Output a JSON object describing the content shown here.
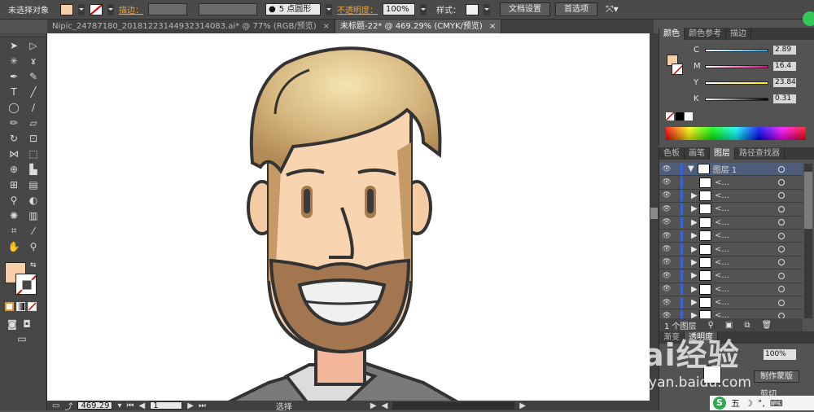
{
  "control_bar": {
    "selection_label": "未选择对象",
    "fill_color": "#f6cfa7",
    "stroke_label": "描边：",
    "brush_value": "5 点圆形",
    "opacity_label": "不透明度：",
    "opacity_value": "100%",
    "style_label": "样式：",
    "doc_setup_button": "文档设置",
    "prefs_button": "首选项"
  },
  "tabs": [
    {
      "label": "Nipic_24787180_20181223144932314083.ai* @ 77% (RGB/预览)",
      "close": "×"
    },
    {
      "label": "未标题-22* @ 469.29% (CMYK/预览)",
      "close": "×"
    }
  ],
  "status_bar": {
    "zoom": "469.29",
    "page": "1",
    "mode": "选择"
  },
  "color_panel": {
    "tabs": [
      "颜色",
      "颜色参考",
      "描边"
    ],
    "channels": [
      {
        "name": "C",
        "value": "2.89",
        "gradient": "linear-gradient(to right,#fff,#00aeef)"
      },
      {
        "name": "M",
        "value": "16.4",
        "gradient": "linear-gradient(to right,#fff,#ec008c)"
      },
      {
        "name": "Y",
        "value": "23.84",
        "gradient": "linear-gradient(to right,#fff,#fff200)"
      },
      {
        "name": "K",
        "value": "0.31",
        "gradient": "linear-gradient(to right,#fff,#000)"
      }
    ],
    "current_fill": "#f6cfa7"
  },
  "layers_panel": {
    "tabs": [
      "色板",
      "画笔",
      "图层",
      "路径查找器"
    ],
    "top_layer": "图层 1",
    "sublayer_label": "<...",
    "sublayer_count": 11,
    "footer": "1 个图层"
  },
  "transparency_panel": {
    "tabs": [
      "渐变",
      "透明度"
    ],
    "opacity": "100%",
    "mask_button": "制作蒙版",
    "clip_label": "剪切"
  },
  "watermark": {
    "brand": "Bai经验",
    "url": "jingyan.baidu.com"
  },
  "taskbar": {
    "ime": "五"
  }
}
